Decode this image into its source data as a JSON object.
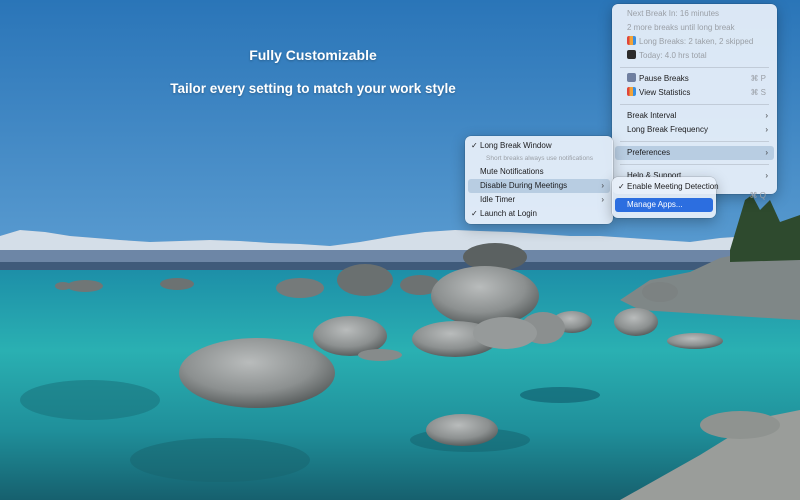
{
  "headline": {
    "title": "Fully Customizable",
    "subtitle": "Tailor every setting to match your work style"
  },
  "main_menu": {
    "status": [
      {
        "label": "Next Break In: 16 minutes",
        "icon": ""
      },
      {
        "label": "2 more breaks until long break",
        "icon": ""
      },
      {
        "label": "Long Breaks: 2 taken, 2 skipped",
        "icon": "bar-chart-icon"
      },
      {
        "label": "Today: 4.0 hrs total",
        "icon": "clock-icon"
      }
    ],
    "pause_label": "Pause Breaks",
    "pause_shortcut": "⌘ P",
    "stats_label": "View Statistics",
    "stats_shortcut": "⌘ S",
    "interval_label": "Break Interval",
    "frequency_label": "Long Break Frequency",
    "preferences_label": "Preferences",
    "help_label": "Help & Support",
    "quit_shortcut": "⌘ Q",
    "chevron": "›",
    "checkmark": "✓"
  },
  "prefs_menu": {
    "long_break_window": "Long Break Window",
    "long_break_hint": "Short breaks always use notifications",
    "mute": "Mute Notifications",
    "disable_meetings": "Disable During Meetings",
    "idle_timer": "Idle Timer",
    "launch_login": "Launch at Login"
  },
  "meeting_menu": {
    "enable_detection": "Enable Meeting Detection",
    "manage_apps": "Manage Apps..."
  },
  "colors": {
    "accent": "#2c6ee0",
    "highlight": "#b8cde2",
    "pause_icon": "#6f7fa0",
    "stats_icon": "#e0463a"
  }
}
